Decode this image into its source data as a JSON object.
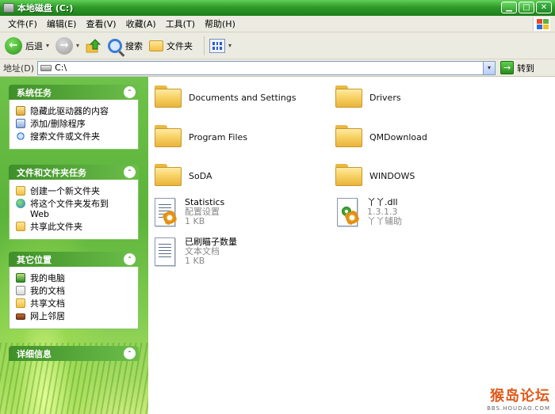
{
  "window": {
    "title": "本地磁盘 (C:)",
    "min_glyph": "▁",
    "max_glyph": "□",
    "close_glyph": "✕"
  },
  "menu": {
    "items": [
      "文件(F)",
      "编辑(E)",
      "查看(V)",
      "收藏(A)",
      "工具(T)",
      "帮助(H)"
    ]
  },
  "toolbar": {
    "back_label": "后退",
    "search_label": "搜索",
    "folders_label": "文件夹",
    "back_glyph": "←",
    "forward_glyph": "→",
    "dropdown_glyph": "▾"
  },
  "address": {
    "label": "地址(D)",
    "value": "C:\\",
    "go_label": "转到",
    "go_glyph": "→",
    "dropdown_glyph": "▾"
  },
  "left_panels": [
    {
      "title": "系统任务",
      "items": [
        "隐藏此驱动器的内容",
        "添加/删除程序",
        "搜索文件或文件夹"
      ]
    },
    {
      "title": "文件和文件夹任务",
      "items": [
        "创建一个新文件夹",
        "将这个文件夹发布到\nWeb",
        "共享此文件夹"
      ]
    },
    {
      "title": "其它位置",
      "items": [
        "我的电脑",
        "我的文档",
        "共享文档",
        "网上邻居"
      ]
    },
    {
      "title": "详细信息",
      "items": []
    }
  ],
  "collapse_glyph": "⌃",
  "files": [
    {
      "name": "Documents and Settings",
      "type": "folder"
    },
    {
      "name": "Drivers",
      "type": "folder"
    },
    {
      "name": "Program Files",
      "type": "folder"
    },
    {
      "name": "QMDownload",
      "type": "folder"
    },
    {
      "name": "SoDA",
      "type": "folder"
    },
    {
      "name": "WINDOWS",
      "type": "folder"
    },
    {
      "name": "Statistics",
      "type": "config",
      "line2": "配置设置",
      "line3": "1 KB"
    },
    {
      "name": "丫丫.dll",
      "type": "dll",
      "line2": "1.3.1.3",
      "line3": "丫丫辅助"
    },
    {
      "name": "已刷瞄子数量",
      "type": "text",
      "line2": "文本文档",
      "line3": "1 KB"
    }
  ],
  "watermark": {
    "main": "猴岛论坛",
    "sub": "BBS.HOUDAO.COM"
  },
  "colors": {
    "titlebar": "#2f9a2a",
    "panel_header": "#3f8f2a",
    "folder": "#f8d265"
  }
}
